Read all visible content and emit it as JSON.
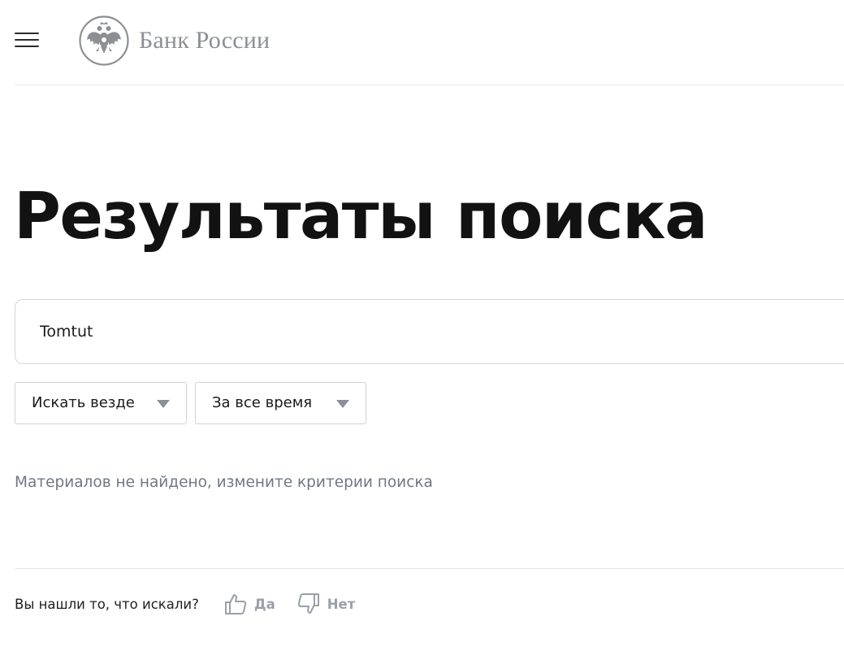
{
  "header": {
    "menu_icon": "hamburger-menu-icon",
    "logo_icon": "double-headed-eagle-emblem",
    "logo_text": "Банк России"
  },
  "page": {
    "title": "Результаты поиска"
  },
  "search": {
    "value": "Tomtut",
    "placeholder": ""
  },
  "filters": {
    "scope": {
      "selected": "Искать везде"
    },
    "period": {
      "selected": "За все время"
    }
  },
  "results": {
    "empty_message": "Материалов не найдено, измените критерии поиска"
  },
  "feedback": {
    "question": "Вы нашли то, что искали?",
    "yes_label": "Да",
    "no_label": "Нет",
    "yes_icon": "thumbs-up-icon",
    "no_icon": "thumbs-down-icon"
  },
  "colors": {
    "title": "#121212",
    "muted_text": "#6f7884",
    "logo_gray": "#8c8f94",
    "border": "#d3d5d8",
    "feedback_gray": "#9aa0a8"
  }
}
